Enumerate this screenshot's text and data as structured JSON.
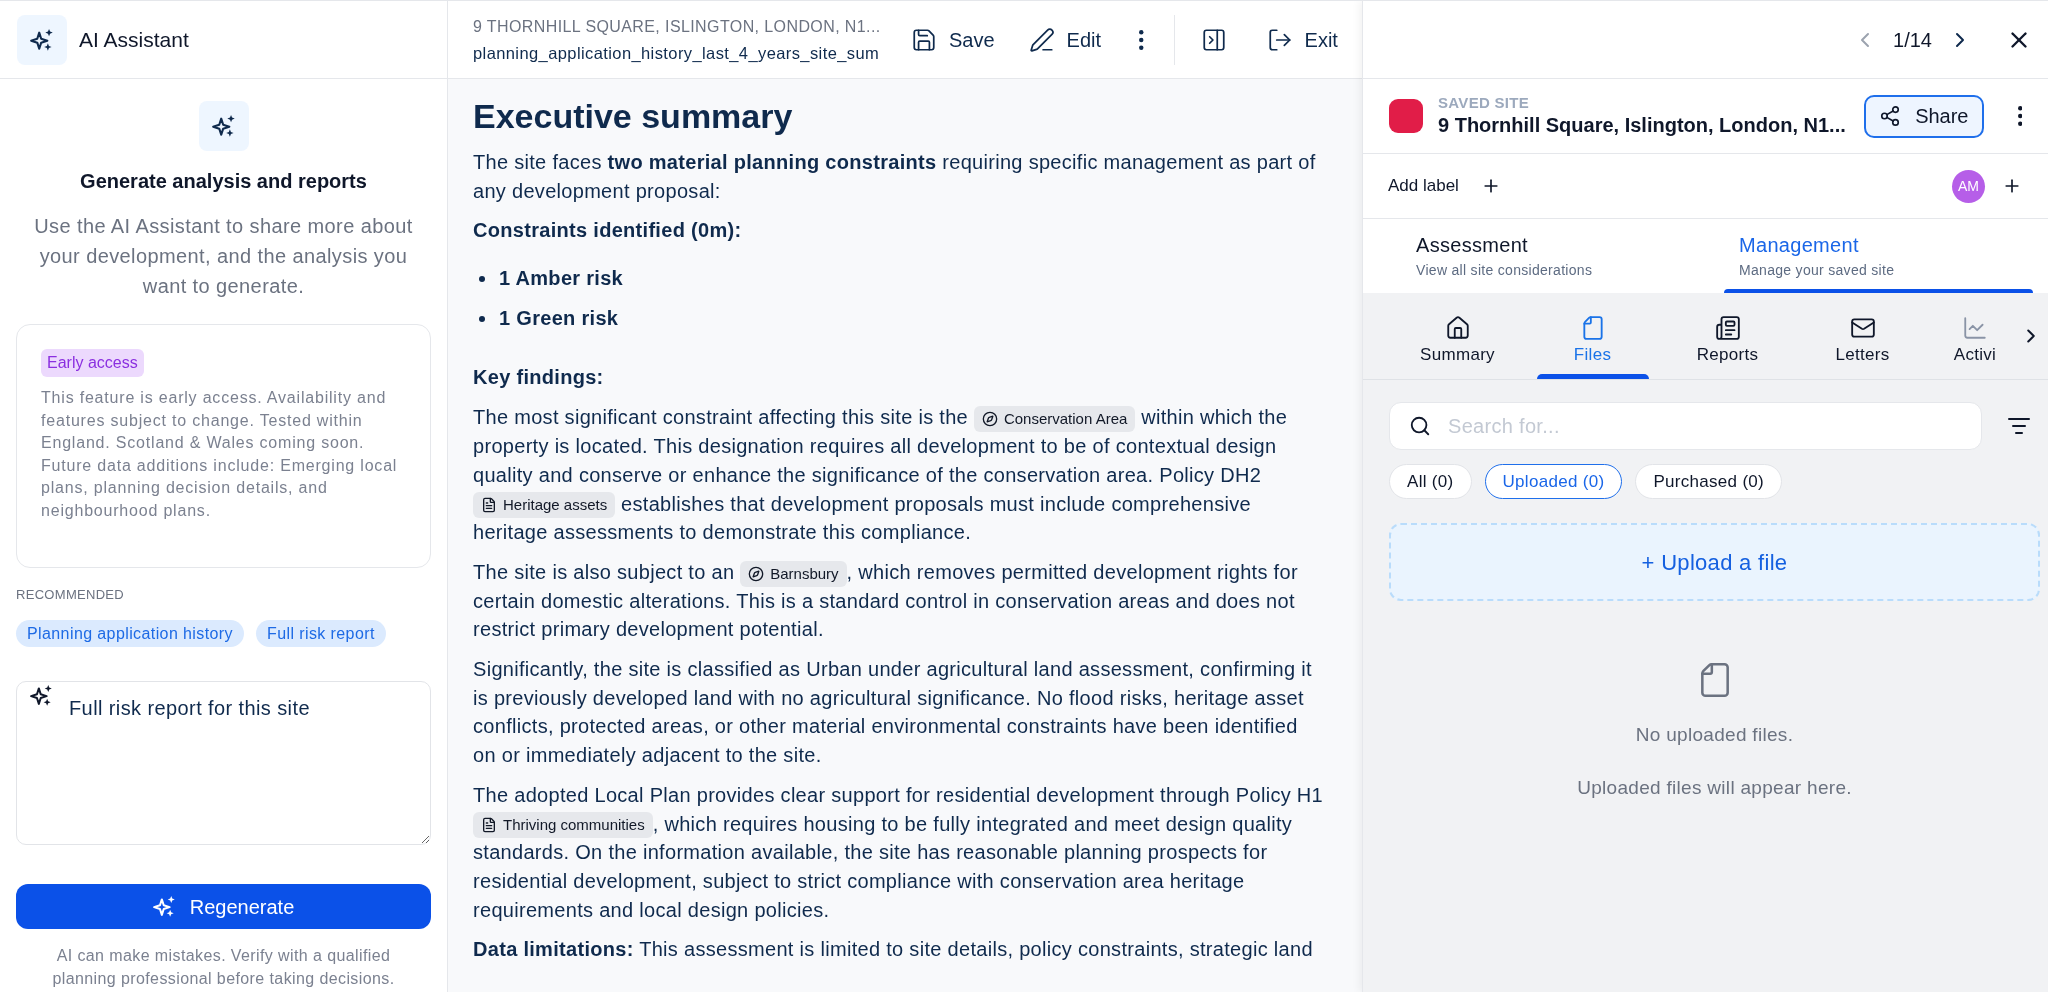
{
  "assistant": {
    "title": "AI Assistant",
    "heading": "Generate analysis and reports",
    "description": "Use the AI Assistant to share more about your development, and the analysis you want to generate.",
    "notice": {
      "badge": "Early access",
      "text": "This feature is early access. Availability and features subject to change. Tested within England. Scotland & Wales coming soon. Future data additions include: Emerging local plans, planning decision details, and neighbourhood plans."
    },
    "recommended": {
      "label": "RECOMMENDED",
      "suggestions": [
        "Planning application history",
        "Full risk report"
      ]
    },
    "prompt": {
      "value": "Full risk report for this site"
    },
    "regenerate_button": "Regenerate",
    "disclaimer": "AI can make mistakes. Verify with a qualified planning professional before taking decisions."
  },
  "document": {
    "address": "9 THORNHILL SQUARE, ISLINGTON, LONDON, N1...",
    "filename": "planning_application_history_last_4_years_site_sum",
    "actions": [
      {
        "kind": "save",
        "label": "Save"
      },
      {
        "kind": "edit",
        "label": "Edit"
      },
      {
        "kind": "more"
      }
    ],
    "view_actions": [
      {
        "kind": "panel"
      },
      {
        "kind": "exit",
        "label": "Exit"
      }
    ],
    "content": [
      {
        "kind": "title",
        "text": "Executive summary"
      },
      {
        "kind": "paragraph",
        "parts": [
          {
            "kind": "text",
            "text": "The site faces **two material planning constraints** requiring specific management as part of any development proposal:"
          }
        ]
      },
      {
        "kind": "heading",
        "text": "Constraints identified (0m):"
      },
      {
        "kind": "bullets",
        "items": [
          "1 Amber risk",
          "1 Green risk"
        ]
      },
      {
        "kind": "heading",
        "text": "Key findings:"
      },
      {
        "kind": "paragraph",
        "parts": [
          {
            "kind": "text",
            "text": "The most significant constraint affecting this site is the "
          },
          {
            "kind": "area",
            "text": "Conservation Area"
          },
          {
            "kind": "text",
            "text": " within which the property is located. This designation requires all development to be of contextual design quality and conserve or enhance the significance of the conservation area. Policy DH2 "
          },
          {
            "kind": "policy",
            "text": "Heritage assets"
          },
          {
            "kind": "text",
            "text": " establishes that development proposals must include comprehensive heritage assessments to demonstrate this compliance."
          }
        ]
      },
      {
        "kind": "paragraph",
        "parts": [
          {
            "kind": "text",
            "text": "The site is also subject to an "
          },
          {
            "kind": "area",
            "text": "Barnsbury"
          },
          {
            "kind": "text",
            "text": ", which removes permitted development rights for certain domestic alterations. This is a standard control in conservation areas and does not restrict primary development potential."
          }
        ]
      },
      {
        "kind": "paragraph",
        "parts": [
          {
            "kind": "text",
            "text": "Significantly, the site is classified as Urban under agricultural land assessment, confirming it is previously developed land with no agricultural significance. No flood risks, heritage asset conflicts, protected areas, or other material environmental constraints have been identified on or immediately adjacent to the site."
          }
        ]
      },
      {
        "kind": "paragraph",
        "parts": [
          {
            "kind": "text",
            "text": "The adopted Local Plan provides clear support for residential development through Policy H1 "
          },
          {
            "kind": "policy",
            "text": "Thriving communities"
          },
          {
            "kind": "text",
            "text": ", which requires housing to be fully integrated and meet design quality standards. On the information available, the site has reasonable planning prospects for residential development, subject to strict compliance with conservation area heritage requirements and local design policies."
          }
        ]
      },
      {
        "kind": "paragraph",
        "parts": [
          {
            "kind": "text",
            "text": "**Data limitations:** This assessment is limited to site details, policy constraints, strategic land"
          }
        ]
      }
    ]
  },
  "site_panel": {
    "pager": {
      "previous": {
        "disabled": true
      },
      "position": "1/14",
      "next": {
        "disabled": false
      }
    },
    "site": {
      "label": "SAVED SITE",
      "color": "#e11d48",
      "name": "9 Thornhill Square, Islington, London, N1...",
      "share_button": "Share"
    },
    "labels": {
      "add_label": "Add label",
      "avatar": "AM"
    },
    "sections": [
      {
        "title": "Assessment",
        "subtitle": "View all site considerations",
        "selected": false
      },
      {
        "title": "Management",
        "subtitle": "Manage your saved site",
        "selected": true
      }
    ],
    "tabs": [
      {
        "kind": "summary",
        "label": "Summary",
        "selected": false
      },
      {
        "kind": "files",
        "label": "Files",
        "selected": true
      },
      {
        "kind": "reports",
        "label": "Reports",
        "selected": false
      },
      {
        "kind": "letters",
        "label": "Letters",
        "selected": false
      },
      {
        "kind": "activity",
        "label": "Activi",
        "selected": false
      }
    ],
    "files": {
      "search": {
        "placeholder": "Search for..."
      },
      "filters": [
        {
          "label": "All (0)",
          "selected": false
        },
        {
          "label": "Uploaded (0)",
          "selected": true
        },
        {
          "label": "Purchased (0)",
          "selected": false
        }
      ],
      "upload_button": "+ Upload a file",
      "empty_state": {
        "title": "No uploaded files.",
        "hint": "Uploaded files will appear here."
      }
    }
  }
}
